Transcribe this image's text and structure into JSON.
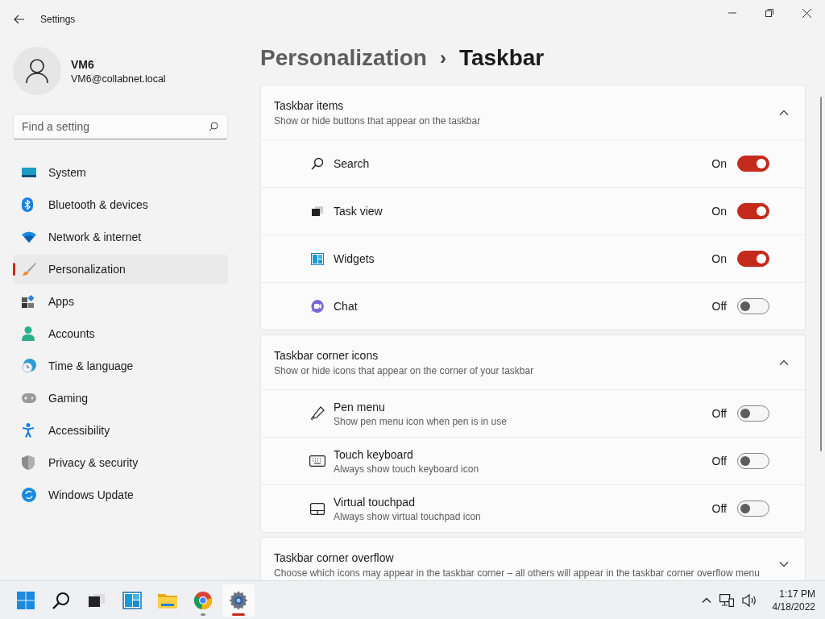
{
  "window": {
    "title": "Settings"
  },
  "user": {
    "name": "VM6",
    "email": "VM6@collabnet.local"
  },
  "search": {
    "placeholder": "Find a setting"
  },
  "nav": [
    {
      "label": "System",
      "selected": false
    },
    {
      "label": "Bluetooth & devices",
      "selected": false
    },
    {
      "label": "Network & internet",
      "selected": false
    },
    {
      "label": "Personalization",
      "selected": true
    },
    {
      "label": "Apps",
      "selected": false
    },
    {
      "label": "Accounts",
      "selected": false
    },
    {
      "label": "Time & language",
      "selected": false
    },
    {
      "label": "Gaming",
      "selected": false
    },
    {
      "label": "Accessibility",
      "selected": false
    },
    {
      "label": "Privacy & security",
      "selected": false
    },
    {
      "label": "Windows Update",
      "selected": false
    }
  ],
  "breadcrumb": {
    "parent": "Personalization",
    "separator": "›",
    "current": "Taskbar"
  },
  "sections": [
    {
      "title": "Taskbar items",
      "description": "Show or hide buttons that appear on the taskbar",
      "expanded": true,
      "items": [
        {
          "label": "Search",
          "status": "On",
          "on": true
        },
        {
          "label": "Task view",
          "status": "On",
          "on": true
        },
        {
          "label": "Widgets",
          "status": "On",
          "on": true
        },
        {
          "label": "Chat",
          "status": "Off",
          "on": false
        }
      ]
    },
    {
      "title": "Taskbar corner icons",
      "description": "Show or hide icons that appear on the corner of your taskbar",
      "expanded": true,
      "items": [
        {
          "label": "Pen menu",
          "description": "Show pen menu icon when pen is in use",
          "status": "Off",
          "on": false
        },
        {
          "label": "Touch keyboard",
          "description": "Always show touch keyboard icon",
          "status": "Off",
          "on": false
        },
        {
          "label": "Virtual touchpad",
          "description": "Always show virtual touchpad icon",
          "status": "Off",
          "on": false
        }
      ]
    },
    {
      "title": "Taskbar corner overflow",
      "description": "Choose which icons may appear in the taskbar corner – all others will appear in the taskbar corner overflow menu",
      "expanded": false
    }
  ],
  "taskbar": {
    "apps": [
      {
        "running": false,
        "selected": false
      },
      {
        "running": false,
        "selected": false
      },
      {
        "running": false,
        "selected": false
      },
      {
        "running": false,
        "selected": false
      },
      {
        "running": false,
        "selected": false
      },
      {
        "running": true,
        "selected": false
      },
      {
        "running": true,
        "selected": true
      }
    ],
    "time": "1:17 PM",
    "date": "4/18/2022"
  }
}
